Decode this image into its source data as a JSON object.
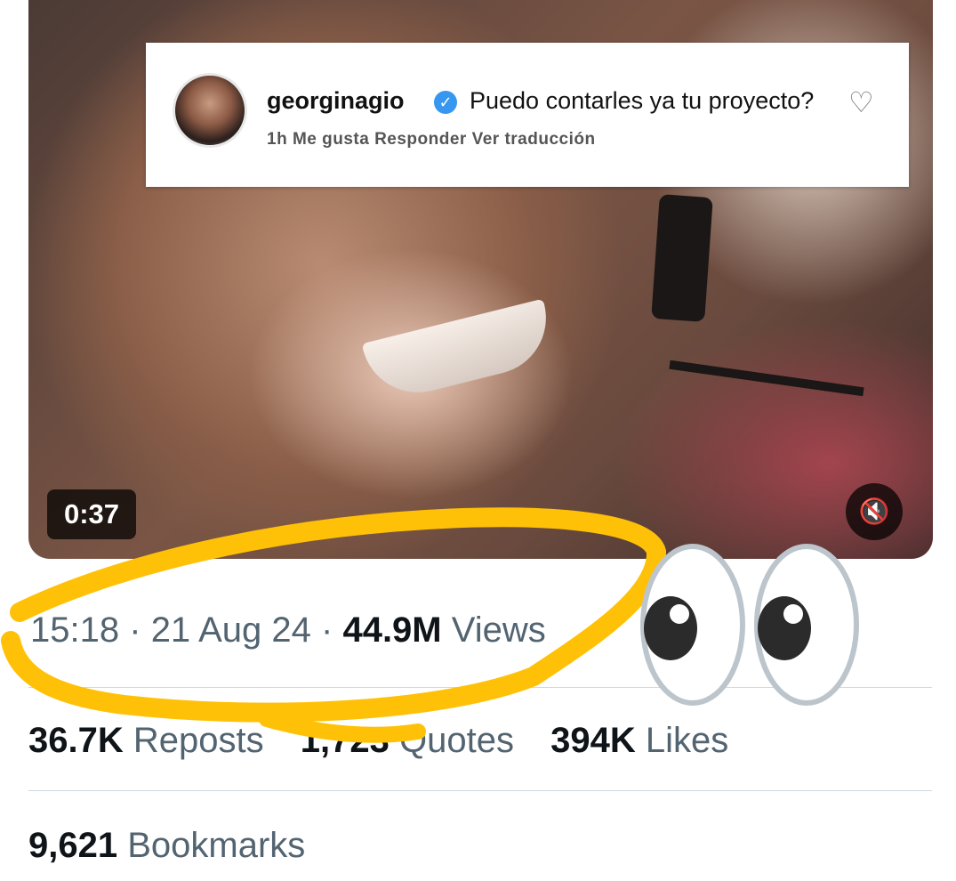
{
  "video": {
    "duration": "0:37",
    "mute_icon": "speaker-muted-icon",
    "overlay_comment": {
      "username": "georginagio",
      "verified_icon": "verified-badge-icon",
      "text": "Puedo contarles ya tu proyecto?",
      "meta": "1h Me gusta Responder Ver traducción",
      "heart_icon": "heart-outline-icon"
    }
  },
  "tweet_meta": {
    "time": "15:18",
    "separator": "·",
    "date": "21 Aug 24",
    "views_count": "44.9M",
    "views_label": "Views"
  },
  "stats": {
    "reposts_count": "36.7K",
    "reposts_label": "Reposts",
    "quotes_count": "1,723",
    "quotes_label": "Quotes",
    "likes_count": "394K",
    "likes_label": "Likes",
    "bookmarks_count": "9,621",
    "bookmarks_label": "Bookmarks"
  },
  "annotations": {
    "circle_color": "#FFC107",
    "eyes_emoji": "eyes-emoji-icon"
  }
}
